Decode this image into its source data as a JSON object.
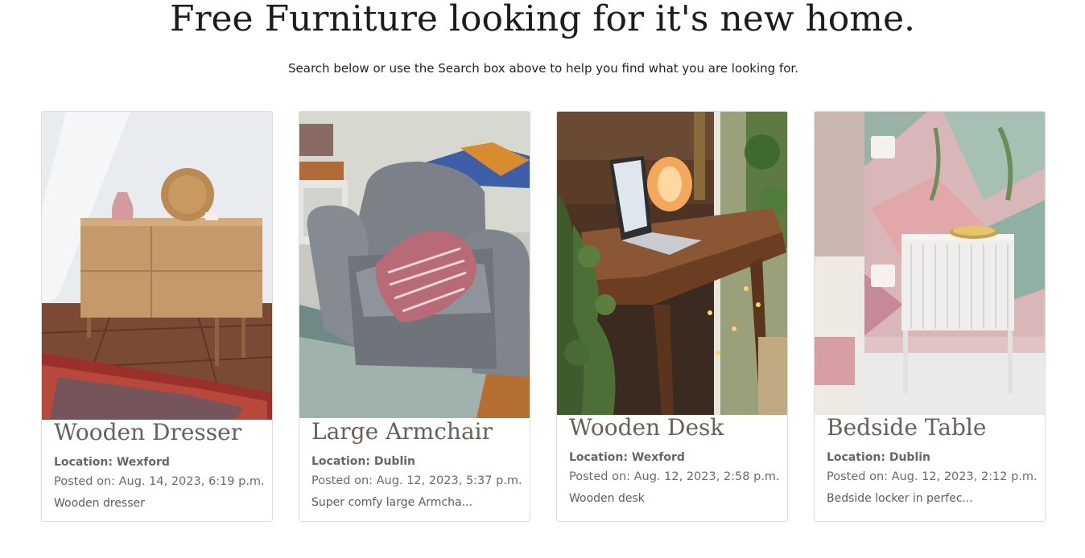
{
  "header": {
    "title": "Free Furniture looking for it's new home.",
    "subtitle": "Search below or use the Search box above to help you find what you are looking for."
  },
  "listings": [
    {
      "title": "Wooden Dresser",
      "location": "Location: Wexford",
      "posted": "Posted on: Aug. 14, 2023, 6:19 p.m.",
      "description": "Wooden dresser",
      "image_alt": "Wooden dresser photo"
    },
    {
      "title": "Large Armchair",
      "location": "Location: Dublin",
      "posted": "Posted on: Aug. 12, 2023, 5:37 p.m.",
      "description": "Super comfy large Armcha...",
      "image_alt": "Large armchair photo"
    },
    {
      "title": "Wooden Desk",
      "location": "Location: Wexford",
      "posted": "Posted on: Aug. 12, 2023, 2:58 p.m.",
      "description": "Wooden desk",
      "image_alt": "Wooden desk photo"
    },
    {
      "title": "Bedside Table",
      "location": "Location: Dublin",
      "posted": "Posted on: Aug. 12, 2023, 2:12 p.m.",
      "description": "Bedside locker in perfec...",
      "image_alt": "Bedside table photo"
    }
  ],
  "colors": {
    "title_text": "#6b5f5a",
    "card_border": "#dcdcdc"
  }
}
